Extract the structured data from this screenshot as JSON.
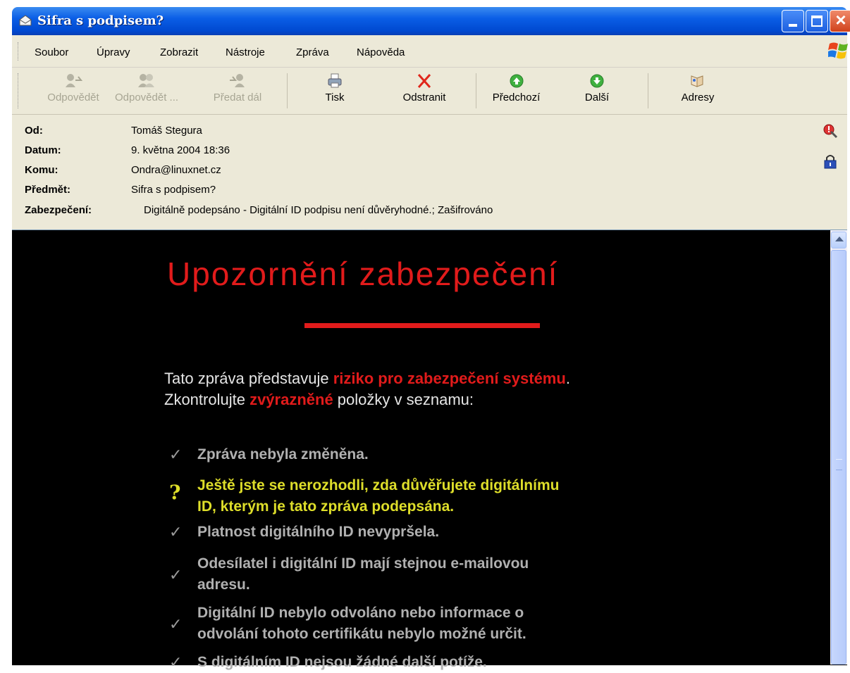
{
  "window": {
    "title": "Sifra s podpisem?"
  },
  "menu": [
    "Soubor",
    "Úpravy",
    "Zobrazit",
    "Nástroje",
    "Zpráva",
    "Nápověda"
  ],
  "toolbar": {
    "reply": "Odpovědět",
    "reply_all": "Odpovědět ...",
    "forward": "Předat dál",
    "print": "Tisk",
    "delete": "Odstranit",
    "previous": "Předchozí",
    "next": "Další",
    "addresses": "Adresy"
  },
  "header": {
    "from_label": "Od:",
    "from": "Tomáš Stegura",
    "date_label": "Datum:",
    "date": "9. května 2004 18:36",
    "to_label": "Komu:",
    "to": "Ondra@linuxnet.cz",
    "subject_label": "Předmět:",
    "subject": "Sifra s podpisem?",
    "security_label": "Zabezpečení:",
    "security": "Digitálně podepsáno - Digitální ID podpisu není důvěryhodné.;  Zašifrováno"
  },
  "body": {
    "title": "Upozornění zabezpečení",
    "intro_1": "Tato zpráva představuje ",
    "intro_hl1": "riziko pro zabezpečení systému",
    "intro_2": ".",
    "intro_3": "Zkontrolujte ",
    "intro_hl2": "zvýrazněné",
    "intro_4": " položky v seznamu:",
    "items": [
      {
        "mark": "✓",
        "lines": [
          "Zpráva nebyla změněna."
        ]
      },
      {
        "mark": "?",
        "lines": [
          "Ještě jste se nerozhodli, zda důvěřujete digitálnímu",
          "ID, kterým je tato zpráva podepsána."
        ]
      },
      {
        "mark": "✓",
        "lines": [
          "Platnost digitálního ID nevypršela."
        ]
      },
      {
        "mark": "✓",
        "lines": [
          "Odesílatel i digitální ID mají stejnou e-mailovou",
          "adresu."
        ]
      },
      {
        "mark": "✓",
        "lines": [
          "Digitální ID nebylo odvoláno nebo informace o",
          "odvolání tohoto certifikátu nebylo možné určit."
        ]
      },
      {
        "mark": "✓",
        "lines": [
          "S digitálním ID nejsou žádné další potíže."
        ]
      }
    ]
  }
}
